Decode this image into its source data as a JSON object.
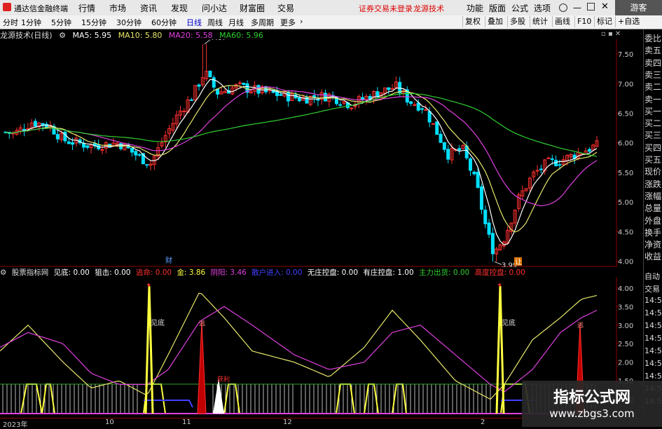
{
  "menubar": {
    "app_title": "通达信金融终端",
    "menus": [
      "行情",
      "市场",
      "资讯",
      "发现",
      "问小达",
      "财富圈",
      "交易"
    ],
    "notice": "证券交易未登录",
    "notice2": "龙源技术",
    "right": [
      "功能",
      "版面",
      "公式",
      "选项"
    ],
    "guest": "游客"
  },
  "period_tabs": [
    "分时",
    "1分钟",
    "5分钟",
    "15分钟",
    "30分钟",
    "60分钟",
    "日线",
    "周线",
    "月线",
    "多周期",
    "更多"
  ],
  "active_period": "日线",
  "right_tools": [
    "复权",
    "叠加",
    "多股",
    "统计",
    "画线",
    "F10",
    "标记",
    "+自选"
  ],
  "chart_header": {
    "name": "龙源技术(日线)",
    "ma": [
      {
        "label": "MA5: 5.95",
        "color": "#ffffff"
      },
      {
        "label": "MA10: 5.80",
        "color": "#e8e86a"
      },
      {
        "label": "MA20: 5.58",
        "color": "#e040e0"
      },
      {
        "label": "MA60: 5.96",
        "color": "#30d030"
      }
    ]
  },
  "main_axis_labels": [
    "7.50",
    "7.00",
    "6.50",
    "6.00",
    "5.50",
    "5.00",
    "4.50",
    "4.00"
  ],
  "price_max_label": "7.67",
  "price_min_label": "3.99",
  "markers": {
    "cai": "财",
    "rang": "让"
  },
  "indicator_header": {
    "name": "股票指标网",
    "items": [
      {
        "label": "见底: 0.00",
        "color": "#ffffff"
      },
      {
        "label": "狙击: 0.00",
        "color": "#ffffff"
      },
      {
        "label": "逃命: 0.00",
        "color": "#ff3030"
      },
      {
        "label": "金: 3.86",
        "color": "#ffff40"
      },
      {
        "label": "阴阳: 3.46",
        "color": "#e040e0"
      },
      {
        "label": "散户进入: 0.00",
        "color": "#4040ff"
      },
      {
        "label": "无庄控盘: 0.00",
        "color": "#ffffff"
      },
      {
        "label": "有庄控盘: 1.00",
        "color": "#ffffff"
      },
      {
        "label": "主力出货: 0.00",
        "color": "#30d030"
      },
      {
        "label": "高度控盘: 0.00",
        "color": "#ff3030"
      }
    ]
  },
  "ind_axis_labels": [
    "4.00",
    "3.50",
    "3.00",
    "2.50",
    "2.00",
    "1.50",
    "1.00"
  ],
  "ind_text": {
    "jiandi": "见底",
    "tao": "逃",
    "huoli": "获利"
  },
  "side_panel": [
    "委比",
    "卖五",
    "卖四",
    "卖三",
    "卖二",
    "卖一",
    "买一",
    "买二",
    "买三",
    "买四",
    "买五",
    "现价",
    "涨跌",
    "涨幅",
    "总量",
    "外盘",
    "换手",
    "净资",
    "收益"
  ],
  "side_panel2": [
    "自动",
    "交易",
    "14:5",
    "14:5",
    "14:5",
    "14:5",
    "14:5",
    "14:5",
    "14:5",
    "14:5",
    "14:5"
  ],
  "date_labels": [
    "2023年",
    "10",
    "11",
    "12",
    "2"
  ],
  "watermark": {
    "line1": "指标公式网",
    "line2": "www.zbgs3.com"
  },
  "colors": {
    "up": "#ff3030",
    "down": "#00e0ff",
    "ma5": "#ffffff",
    "ma10": "#e8e86a",
    "ma20": "#e040e0",
    "ma60": "#30d030",
    "axis_red": "#8b0000"
  }
}
